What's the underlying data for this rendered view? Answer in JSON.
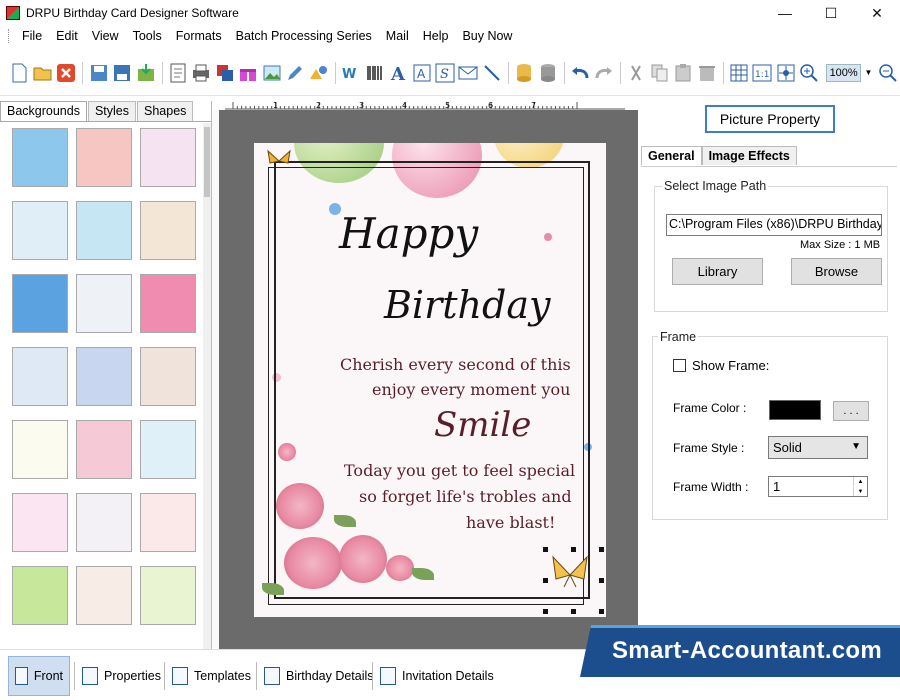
{
  "window": {
    "title": "DRPU Birthday Card Designer Software",
    "controls": {
      "minimize": "—",
      "maximize": "☐",
      "close": "✕"
    }
  },
  "menu": [
    "File",
    "Edit",
    "View",
    "Tools",
    "Formats",
    "Batch Processing Series",
    "Mail",
    "Help",
    "Buy Now"
  ],
  "toolbar": {
    "icons": [
      "new-icon",
      "open-icon",
      "close-icon",
      "save-icon",
      "save-as-icon",
      "export-icon",
      "print-preview-icon",
      "print-icon",
      "layers-icon",
      "gift-icon",
      "image-icon",
      "pen-icon",
      "shapes-icon",
      "watermark-icon",
      "barcode-icon",
      "text-icon",
      "text-box-icon",
      "signature-icon",
      "email-icon",
      "line-icon",
      "database-icon",
      "database-list-icon",
      "undo-icon",
      "redo-icon",
      "cut-icon",
      "copy-icon",
      "paste-icon",
      "delete-icon",
      "grid-icon",
      "actual-size-icon",
      "fit-icon",
      "zoom-in-icon",
      "zoom-out-icon"
    ],
    "zoom": "100%"
  },
  "left_panel": {
    "tabs": [
      "Backgrounds",
      "Styles",
      "Shapes"
    ],
    "active_tab": "Backgrounds",
    "thumbnails": [
      "#8ec7ec",
      "#f5c6c2",
      "#f6e3f2",
      "#dfeef7",
      "#c5e6f2",
      "#f3e6d6",
      "#5aa2e0",
      "#eef2f7",
      "#f08cb0",
      "#dfe9f5",
      "#c9d6ef",
      "#f0e3dc",
      "#fbfbf0",
      "#f6c9d6",
      "#e0f0f8",
      "#fbe5f2",
      "#f4f1f6",
      "#fbe9e9",
      "#c7e89a",
      "#f8ece6",
      "#e8f4d2"
    ]
  },
  "ruler": {
    "marks": [
      "1",
      "2",
      "3",
      "4",
      "5",
      "6",
      "7"
    ]
  },
  "card": {
    "happy": "Happy",
    "birthday": "Birthday",
    "line1": "Cherish every second of this",
    "line2": "enjoy every moment you",
    "smile": "Smile",
    "line3": "Today you get to feel special",
    "line4": "so forget life's trobles and",
    "line5": "have blast!"
  },
  "right_panel": {
    "title": "Picture Property",
    "tabs": [
      "General",
      "Image Effects"
    ],
    "active_tab": "General",
    "image_path_group": "Select Image Path",
    "image_path": "C:\\Program Files (x86)\\DRPU Birthday",
    "max_size": "Max Size : 1 MB",
    "library_button": "Library",
    "browse_button": "Browse",
    "frame_group": "Frame",
    "show_frame_label": "Show Frame:",
    "show_frame_checked": false,
    "frame_color_label": "Frame Color :",
    "frame_color": "#000000",
    "frame_color_button": ". . .",
    "frame_style_label": "Frame Style :",
    "frame_style": "Solid",
    "frame_width_label": "Frame Width :",
    "frame_width": "1"
  },
  "bottom_tabs": [
    "Front",
    "Properties",
    "Templates",
    "Birthday Details",
    "Invitation Details"
  ],
  "active_bottom_tab": "Front",
  "watermark": "Smart-Accountant.com"
}
